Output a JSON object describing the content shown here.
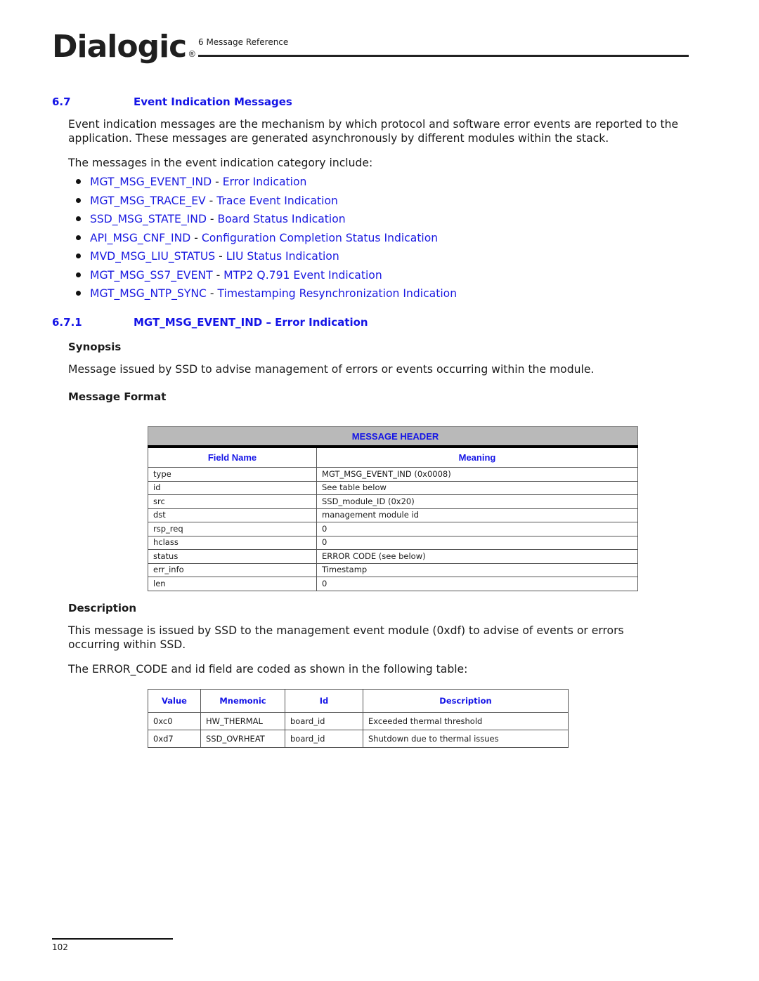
{
  "header": {
    "logo_text": "Dialogic",
    "logo_reg": "®",
    "running_head": "6 Message Reference"
  },
  "section": {
    "number": "6.7",
    "title": "Event Indication Messages",
    "intro": "Event indication messages are the mechanism by which protocol and software error events are reported to the application. These messages are generated asynchronously by different modules within the stack.",
    "list_intro": "The messages in the event indication category include:",
    "items": [
      {
        "name": "MGT_MSG_EVENT_IND",
        "sep": " - ",
        "desc": "Error Indication"
      },
      {
        "name": "MGT_MSG_TRACE_EV",
        "sep": " - ",
        "desc": "Trace Event Indication"
      },
      {
        "name": "SSD_MSG_STATE_IND",
        "sep": " - ",
        "desc": "Board Status Indication"
      },
      {
        "name": "API_MSG_CNF_IND",
        "sep": " - ",
        "desc": "Configuration Completion Status Indication"
      },
      {
        "name": "MVD_MSG_LIU_STATUS",
        "sep": " - ",
        "desc": "LIU Status Indication"
      },
      {
        "name": "MGT_MSG_SS7_EVENT",
        "sep": " - ",
        "desc": "MTP2 Q.791 Event Indication"
      },
      {
        "name": "MGT_MSG_NTP_SYNC",
        "sep": " - ",
        "desc": "Timestamping Resynchronization Indication"
      }
    ]
  },
  "subsection": {
    "number": "6.7.1",
    "title": "MGT_MSG_EVENT_IND – Error Indication",
    "synopsis_heading": "Synopsis",
    "synopsis": "Message issued by SSD to advise management of errors or events occurring within the module.",
    "format_heading": "Message Format",
    "description_heading": "Description",
    "description": "This message is issued by SSD to the management event module (0xdf) to advise of events or errors occurring within SSD.",
    "table_intro": "The ERROR_CODE and id field are coded as shown in the following table:"
  },
  "message_header_table": {
    "band": "MESSAGE HEADER",
    "columns": [
      "Field Name",
      "Meaning"
    ],
    "rows": [
      [
        "type",
        "MGT_MSG_EVENT_IND (0x0008)"
      ],
      [
        "id",
        "See table below"
      ],
      [
        "src",
        "SSD_module_ID (0x20)"
      ],
      [
        "dst",
        "management module id"
      ],
      [
        "rsp_req",
        "0"
      ],
      [
        "hclass",
        "0"
      ],
      [
        "status",
        "ERROR CODE (see below)"
      ],
      [
        "err_info",
        "Timestamp"
      ],
      [
        "len",
        "0"
      ]
    ]
  },
  "error_code_table": {
    "columns": [
      "Value",
      "Mnemonic",
      "Id",
      "Description"
    ],
    "rows": [
      [
        "0xc0",
        "HW_THERMAL",
        "board_id",
        "Exceeded thermal threshold"
      ],
      [
        "0xd7",
        "SSD_OVRHEAT",
        "board_id",
        "Shutdown due to thermal issues"
      ]
    ]
  },
  "footer": {
    "page_number": "102"
  }
}
